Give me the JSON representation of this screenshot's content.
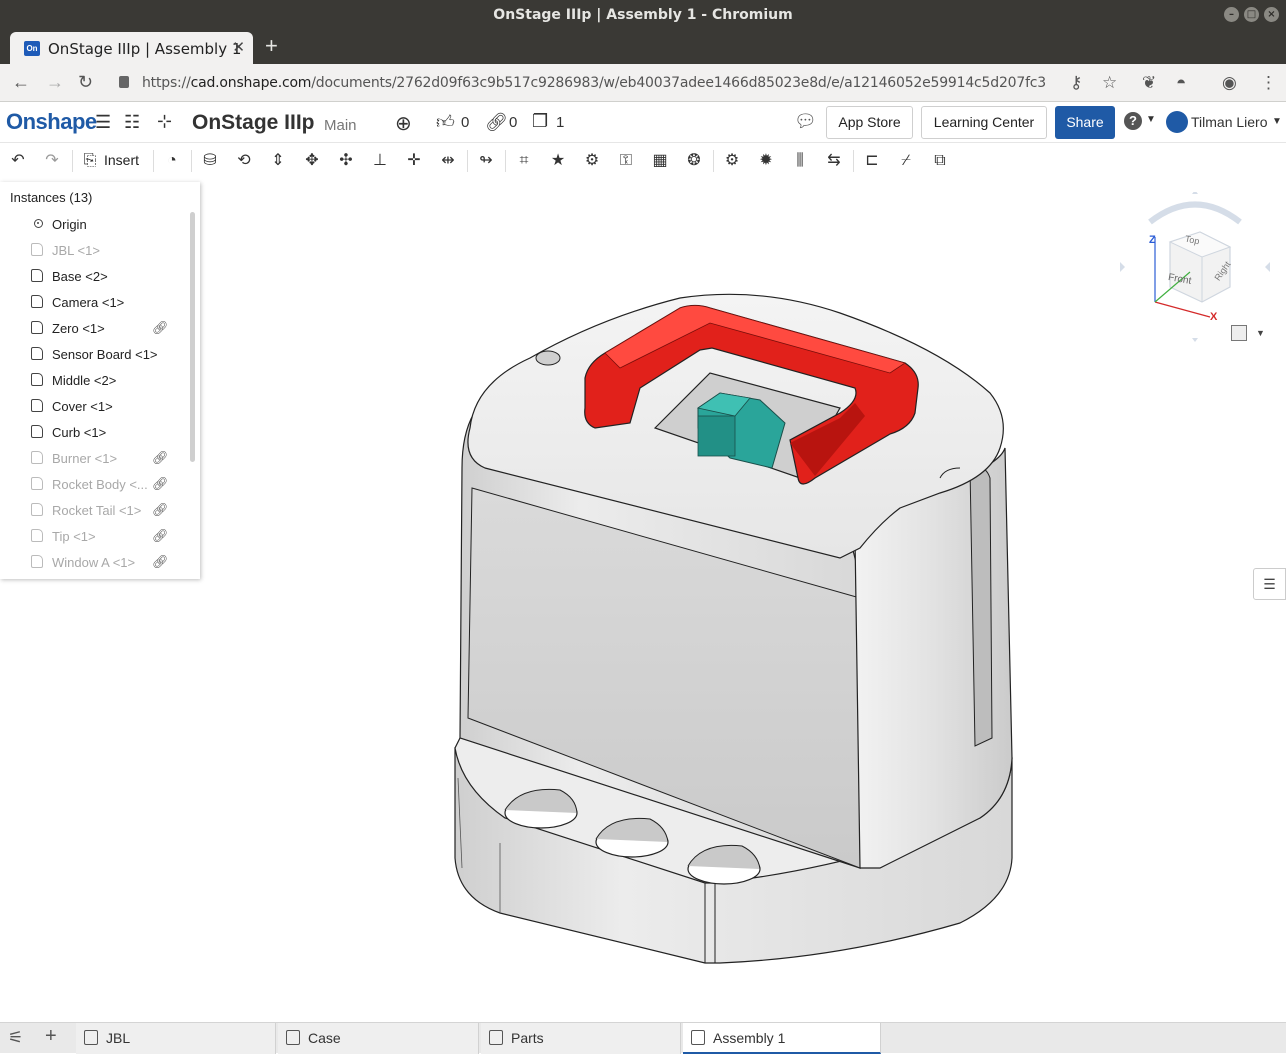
{
  "window": {
    "title": "OnStage IIIp | Assembly 1 - Chromium"
  },
  "browser": {
    "tab_title": "OnStage IIIp | Assembly 1",
    "favicon_text": "On",
    "url_scheme": "https://",
    "url_host": "cad.onshape.com",
    "url_path": "/documents/2762d09f63c9b517c9286983/w/eb40037adee1466d85023e8d/e/a12146052e59914c5d207fc3"
  },
  "header": {
    "logo": "Onshape",
    "document_name": "OnStage IIIp",
    "branch": "Main",
    "likes": "0",
    "links": "0",
    "copies": "1",
    "app_store": "App Store",
    "learning_center": "Learning Center",
    "share": "Share",
    "help": "?",
    "user_name": "Tilman Liero"
  },
  "toolbar": {
    "insert_label": "Insert"
  },
  "instances": {
    "title": "Instances (13)",
    "items": [
      {
        "label": "Origin",
        "type": "origin",
        "suppressed": false,
        "linked": false
      },
      {
        "label": "JBL <1>",
        "type": "part",
        "suppressed": true,
        "linked": false
      },
      {
        "label": "Base <2>",
        "type": "part",
        "suppressed": false,
        "linked": false
      },
      {
        "label": "Camera <1>",
        "type": "part",
        "suppressed": false,
        "linked": false
      },
      {
        "label": "Zero <1>",
        "type": "part",
        "suppressed": false,
        "linked": true
      },
      {
        "label": "Sensor Board <1>",
        "type": "part",
        "suppressed": false,
        "linked": false
      },
      {
        "label": "Middle <2>",
        "type": "part",
        "suppressed": false,
        "linked": false
      },
      {
        "label": "Cover <1>",
        "type": "part",
        "suppressed": false,
        "linked": false
      },
      {
        "label": "Curb <1>",
        "type": "part",
        "suppressed": false,
        "linked": false
      },
      {
        "label": "Burner <1>",
        "type": "part",
        "suppressed": true,
        "linked": true
      },
      {
        "label": "Rocket Body <...",
        "type": "part",
        "suppressed": true,
        "linked": true
      },
      {
        "label": "Rocket Tail <1>",
        "type": "part",
        "suppressed": true,
        "linked": true
      },
      {
        "label": "Tip <1>",
        "type": "part",
        "suppressed": true,
        "linked": true
      },
      {
        "label": "Window A <1>",
        "type": "part",
        "suppressed": true,
        "linked": true
      }
    ]
  },
  "viewcube": {
    "top": "Top",
    "front": "Front",
    "right": "Right",
    "axis_x": "X",
    "axis_z": "Z"
  },
  "bottom_tabs": [
    {
      "label": "JBL",
      "active": false
    },
    {
      "label": "Case",
      "active": false
    },
    {
      "label": "Parts",
      "active": false
    },
    {
      "label": "Assembly 1",
      "active": true
    }
  ],
  "colors": {
    "brand": "#1f5aa6",
    "part_red": "#e1211b",
    "part_teal": "#2aa59a",
    "body_gray": "#d6d6d6"
  }
}
